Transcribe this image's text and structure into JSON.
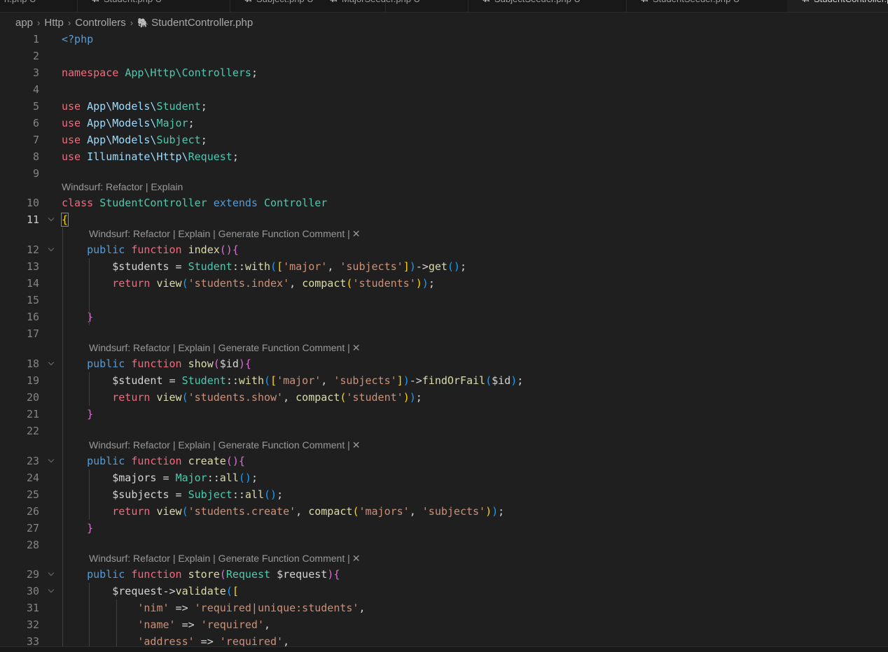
{
  "tabs": [
    {
      "label": "n.php",
      "status": "U"
    },
    {
      "label": "Student.php",
      "status": "U"
    },
    {
      "label": "Subject.php",
      "status": "U"
    },
    {
      "label": "MajorSeeder.php",
      "status": "U"
    },
    {
      "label": "SubjectSeeder.php",
      "status": "U"
    },
    {
      "label": "StudentSeeder.php",
      "status": "U"
    },
    {
      "label": "StudentController.php",
      "status": ""
    }
  ],
  "breadcrumb": [
    "app",
    "Http",
    "Controllers",
    "StudentController.php"
  ],
  "codelens": {
    "class": "Windsurf: Refactor | Explain",
    "method": "Windsurf: Refactor | Explain | Generate Function Comment |",
    "close": "✕"
  },
  "lines": [
    {
      "n": "1",
      "tokens": [
        [
          "tg",
          "<?php"
        ]
      ]
    },
    {
      "n": "2",
      "tokens": []
    },
    {
      "n": "3",
      "tokens": [
        [
          "kw",
          "namespace"
        ],
        [
          "op",
          " "
        ],
        [
          "ty",
          "App\\Http\\Controllers"
        ],
        [
          "op",
          ";"
        ]
      ]
    },
    {
      "n": "4",
      "tokens": []
    },
    {
      "n": "5",
      "tokens": [
        [
          "kw",
          "use"
        ],
        [
          "op",
          " "
        ],
        [
          "ns",
          "App\\Models\\"
        ],
        [
          "ty",
          "Student"
        ],
        [
          "op",
          ";"
        ]
      ]
    },
    {
      "n": "6",
      "tokens": [
        [
          "kw",
          "use"
        ],
        [
          "op",
          " "
        ],
        [
          "ns",
          "App\\Models\\"
        ],
        [
          "ty",
          "Major"
        ],
        [
          "op",
          ";"
        ]
      ]
    },
    {
      "n": "7",
      "tokens": [
        [
          "kw",
          "use"
        ],
        [
          "op",
          " "
        ],
        [
          "ns",
          "App\\Models\\"
        ],
        [
          "ty",
          "Subject"
        ],
        [
          "op",
          ";"
        ]
      ]
    },
    {
      "n": "8",
      "tokens": [
        [
          "kw",
          "use"
        ],
        [
          "op",
          " "
        ],
        [
          "ns",
          "Illuminate\\Http\\"
        ],
        [
          "ty",
          "Request"
        ],
        [
          "op",
          ";"
        ]
      ]
    },
    {
      "n": "9",
      "tokens": []
    },
    {
      "n": "10",
      "tokens": [
        [
          "kw",
          "class"
        ],
        [
          "op",
          " "
        ],
        [
          "ty",
          "StudentController"
        ],
        [
          "op",
          " "
        ],
        [
          "kb",
          "extends"
        ],
        [
          "op",
          " "
        ],
        [
          "ty",
          "Controller"
        ]
      ]
    },
    {
      "n": "11",
      "tokens": [
        [
          "b1",
          "{"
        ]
      ]
    },
    {
      "n": "12",
      "tokens": [
        [
          "op",
          "    "
        ],
        [
          "kb",
          "public"
        ],
        [
          "op",
          " "
        ],
        [
          "kw",
          "function"
        ],
        [
          "op",
          " "
        ],
        [
          "fn",
          "index"
        ],
        [
          "b2",
          "()"
        ],
        [
          "b2",
          "{"
        ]
      ]
    },
    {
      "n": "13",
      "tokens": [
        [
          "op",
          "        "
        ],
        [
          "vr",
          "$students"
        ],
        [
          "op",
          " = "
        ],
        [
          "ty",
          "Student"
        ],
        [
          "op",
          "::"
        ],
        [
          "fn",
          "with"
        ],
        [
          "b3",
          "("
        ],
        [
          "b1",
          "["
        ],
        [
          "st",
          "'major'"
        ],
        [
          "op",
          ", "
        ],
        [
          "st",
          "'subjects'"
        ],
        [
          "b1",
          "]"
        ],
        [
          "b3",
          ")"
        ],
        [
          "op",
          "->"
        ],
        [
          "fn",
          "get"
        ],
        [
          "b3",
          "()"
        ],
        [
          "op",
          ";"
        ]
      ]
    },
    {
      "n": "14",
      "tokens": [
        [
          "op",
          "        "
        ],
        [
          "kw",
          "return"
        ],
        [
          "op",
          " "
        ],
        [
          "fn",
          "view"
        ],
        [
          "b3",
          "("
        ],
        [
          "st",
          "'students.index'"
        ],
        [
          "op",
          ", "
        ],
        [
          "fn",
          "compact"
        ],
        [
          "b1",
          "("
        ],
        [
          "st",
          "'students'"
        ],
        [
          "b1",
          ")"
        ],
        [
          "b3",
          ")"
        ],
        [
          "op",
          ";"
        ]
      ]
    },
    {
      "n": "15",
      "tokens": []
    },
    {
      "n": "16",
      "tokens": [
        [
          "op",
          "    "
        ],
        [
          "b2",
          "}"
        ]
      ]
    },
    {
      "n": "17",
      "tokens": []
    },
    {
      "n": "18",
      "tokens": [
        [
          "op",
          "    "
        ],
        [
          "kb",
          "public"
        ],
        [
          "op",
          " "
        ],
        [
          "kw",
          "function"
        ],
        [
          "op",
          " "
        ],
        [
          "fn",
          "show"
        ],
        [
          "b2",
          "("
        ],
        [
          "vr",
          "$id"
        ],
        [
          "b2",
          ")"
        ],
        [
          "b2",
          "{"
        ]
      ]
    },
    {
      "n": "19",
      "tokens": [
        [
          "op",
          "        "
        ],
        [
          "vr",
          "$student"
        ],
        [
          "op",
          " = "
        ],
        [
          "ty",
          "Student"
        ],
        [
          "op",
          "::"
        ],
        [
          "fn",
          "with"
        ],
        [
          "b3",
          "("
        ],
        [
          "b1",
          "["
        ],
        [
          "st",
          "'major'"
        ],
        [
          "op",
          ", "
        ],
        [
          "st",
          "'subjects'"
        ],
        [
          "b1",
          "]"
        ],
        [
          "b3",
          ")"
        ],
        [
          "op",
          "->"
        ],
        [
          "fn",
          "findOrFail"
        ],
        [
          "b3",
          "("
        ],
        [
          "vr",
          "$id"
        ],
        [
          "b3",
          ")"
        ],
        [
          "op",
          ";"
        ]
      ]
    },
    {
      "n": "20",
      "tokens": [
        [
          "op",
          "        "
        ],
        [
          "kw",
          "return"
        ],
        [
          "op",
          " "
        ],
        [
          "fn",
          "view"
        ],
        [
          "b3",
          "("
        ],
        [
          "st",
          "'students.show'"
        ],
        [
          "op",
          ", "
        ],
        [
          "fn",
          "compact"
        ],
        [
          "b1",
          "("
        ],
        [
          "st",
          "'student'"
        ],
        [
          "b1",
          ")"
        ],
        [
          "b3",
          ")"
        ],
        [
          "op",
          ";"
        ]
      ]
    },
    {
      "n": "21",
      "tokens": [
        [
          "op",
          "    "
        ],
        [
          "b2",
          "}"
        ]
      ]
    },
    {
      "n": "22",
      "tokens": []
    },
    {
      "n": "23",
      "tokens": [
        [
          "op",
          "    "
        ],
        [
          "kb",
          "public"
        ],
        [
          "op",
          " "
        ],
        [
          "kw",
          "function"
        ],
        [
          "op",
          " "
        ],
        [
          "fn",
          "create"
        ],
        [
          "b2",
          "()"
        ],
        [
          "b2",
          "{"
        ]
      ]
    },
    {
      "n": "24",
      "tokens": [
        [
          "op",
          "        "
        ],
        [
          "vr",
          "$majors"
        ],
        [
          "op",
          " = "
        ],
        [
          "ty",
          "Major"
        ],
        [
          "op",
          "::"
        ],
        [
          "fn",
          "all"
        ],
        [
          "b3",
          "()"
        ],
        [
          "op",
          ";"
        ]
      ]
    },
    {
      "n": "25",
      "tokens": [
        [
          "op",
          "        "
        ],
        [
          "vr",
          "$subjects"
        ],
        [
          "op",
          " = "
        ],
        [
          "ty",
          "Subject"
        ],
        [
          "op",
          "::"
        ],
        [
          "fn",
          "all"
        ],
        [
          "b3",
          "()"
        ],
        [
          "op",
          ";"
        ]
      ]
    },
    {
      "n": "26",
      "tokens": [
        [
          "op",
          "        "
        ],
        [
          "kw",
          "return"
        ],
        [
          "op",
          " "
        ],
        [
          "fn",
          "view"
        ],
        [
          "b3",
          "("
        ],
        [
          "st",
          "'students.create'"
        ],
        [
          "op",
          ", "
        ],
        [
          "fn",
          "compact"
        ],
        [
          "b1",
          "("
        ],
        [
          "st",
          "'majors'"
        ],
        [
          "op",
          ", "
        ],
        [
          "st",
          "'subjects'"
        ],
        [
          "b1",
          ")"
        ],
        [
          "b3",
          ")"
        ],
        [
          "op",
          ";"
        ]
      ]
    },
    {
      "n": "27",
      "tokens": [
        [
          "op",
          "    "
        ],
        [
          "b2",
          "}"
        ]
      ]
    },
    {
      "n": "28",
      "tokens": []
    },
    {
      "n": "29",
      "tokens": [
        [
          "op",
          "    "
        ],
        [
          "kb",
          "public"
        ],
        [
          "op",
          " "
        ],
        [
          "kw",
          "function"
        ],
        [
          "op",
          " "
        ],
        [
          "fn",
          "store"
        ],
        [
          "b2",
          "("
        ],
        [
          "ty",
          "Request"
        ],
        [
          "op",
          " "
        ],
        [
          "vr",
          "$request"
        ],
        [
          "b2",
          ")"
        ],
        [
          "b2",
          "{"
        ]
      ]
    },
    {
      "n": "30",
      "tokens": [
        [
          "op",
          "        "
        ],
        [
          "vr",
          "$request"
        ],
        [
          "op",
          "->"
        ],
        [
          "fn",
          "validate"
        ],
        [
          "b3",
          "("
        ],
        [
          "b1",
          "["
        ]
      ]
    },
    {
      "n": "31",
      "tokens": [
        [
          "op",
          "            "
        ],
        [
          "st",
          "'nim'"
        ],
        [
          "op",
          " => "
        ],
        [
          "st",
          "'required|unique:students'"
        ],
        [
          "op",
          ","
        ]
      ]
    },
    {
      "n": "32",
      "tokens": [
        [
          "op",
          "            "
        ],
        [
          "st",
          "'name'"
        ],
        [
          "op",
          " => "
        ],
        [
          "st",
          "'required'"
        ],
        [
          "op",
          ","
        ]
      ]
    },
    {
      "n": "33",
      "tokens": [
        [
          "op",
          "            "
        ],
        [
          "st",
          "'address'"
        ],
        [
          "op",
          " => "
        ],
        [
          "st",
          "'required'"
        ],
        [
          "op",
          ","
        ]
      ]
    }
  ]
}
